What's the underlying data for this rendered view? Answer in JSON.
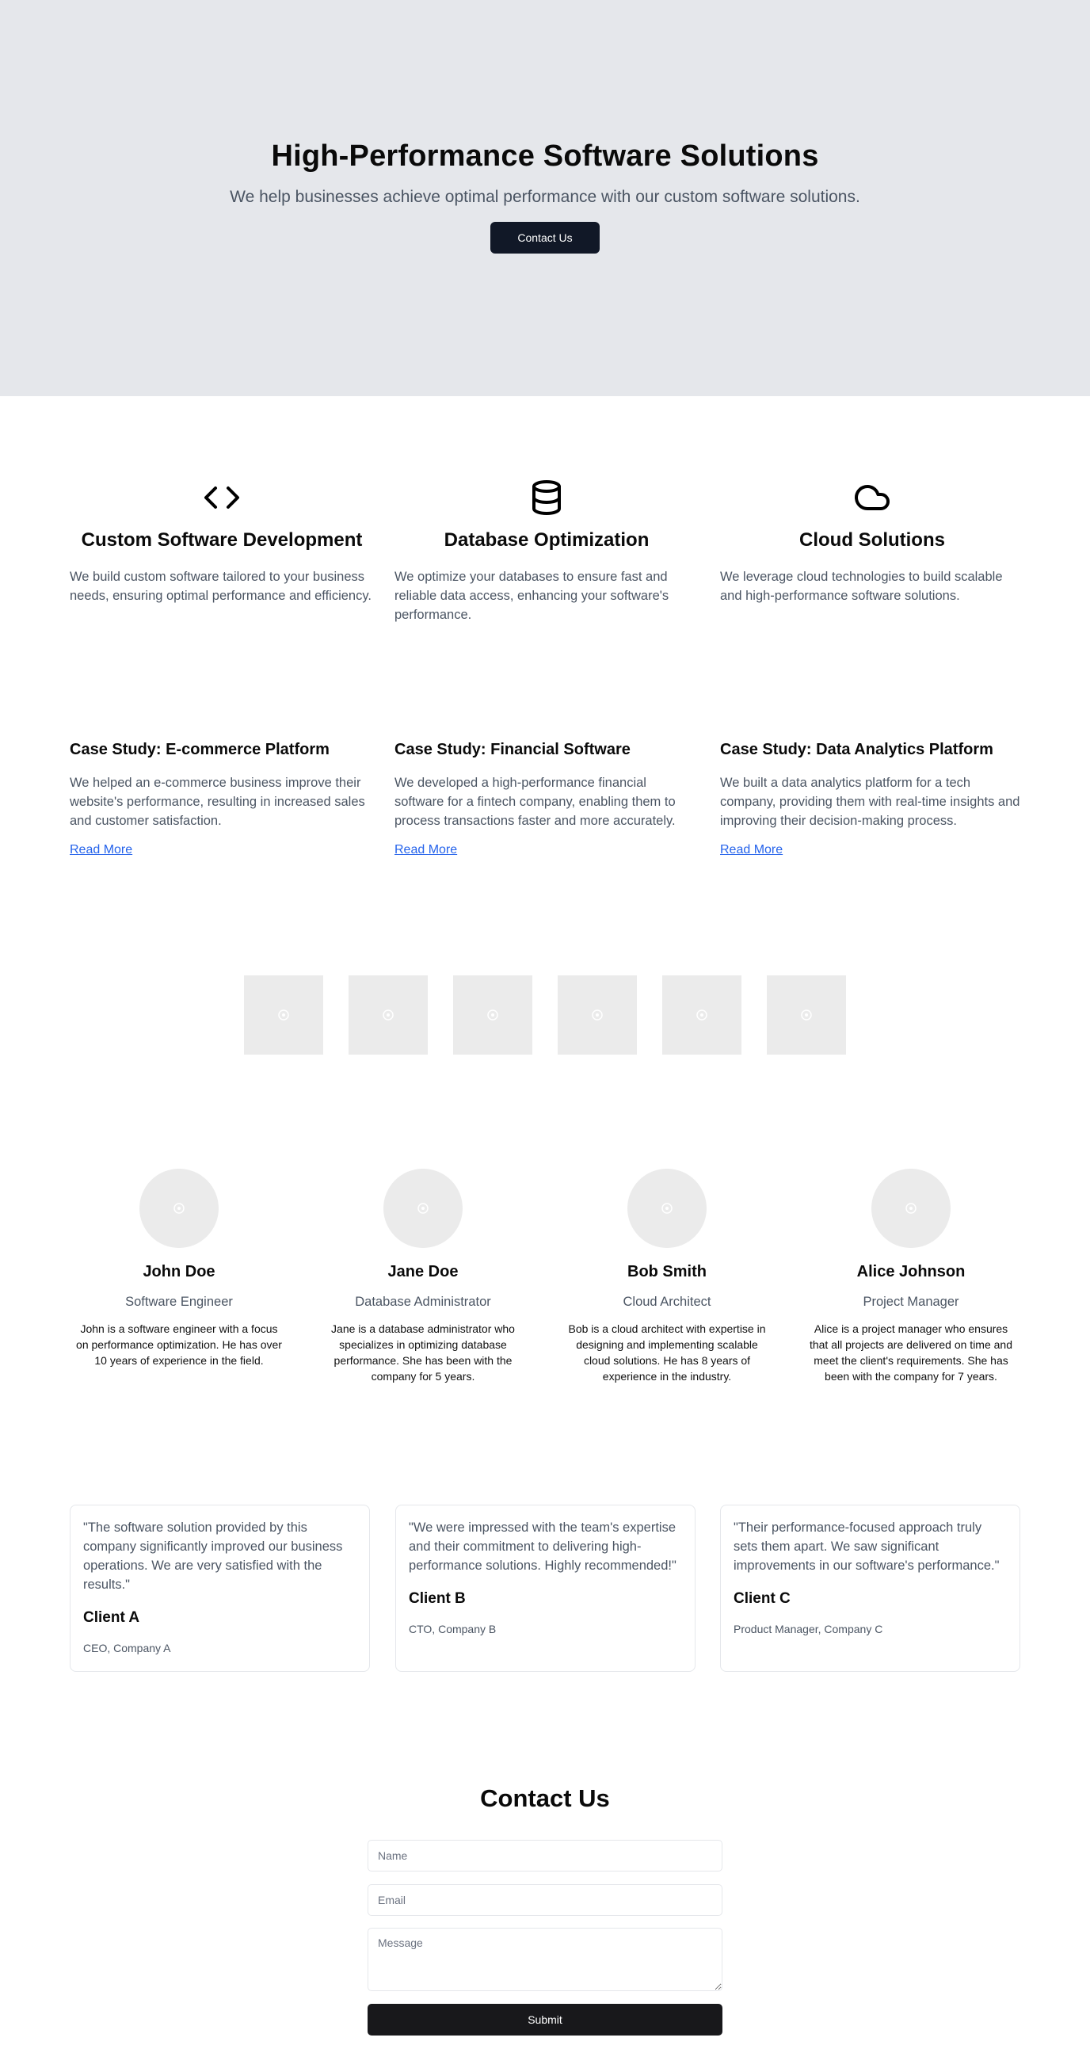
{
  "hero": {
    "title": "High-Performance Software Solutions",
    "subtitle": "We help businesses achieve optimal performance with our custom software solutions.",
    "cta_label": "Contact Us",
    "background": "#e5e7eb",
    "button_color": "#111827"
  },
  "services": [
    {
      "icon": "code-icon",
      "title": "Custom Software Development",
      "description": "We build custom software tailored to your business needs, ensuring optimal performance and efficiency."
    },
    {
      "icon": "database-icon",
      "title": "Database Optimization",
      "description": "We optimize your databases to ensure fast and reliable data access, enhancing your software's performance."
    },
    {
      "icon": "cloud-icon",
      "title": "Cloud Solutions",
      "description": "We leverage cloud technologies to build scalable and high-performance software solutions."
    }
  ],
  "case_studies": [
    {
      "title": "Case Study: E-commerce Platform",
      "description": "We helped an e-commerce business improve their website's performance, resulting in increased sales and customer satisfaction.",
      "link": "Read More"
    },
    {
      "title": "Case Study: Financial Software",
      "description": "We developed a high-performance financial software for a fintech company, enabling them to process transactions faster and more accurately.",
      "link": "Read More"
    },
    {
      "title": "Case Study: Data Analytics Platform",
      "description": "We built a data analytics platform for a tech company, providing them with real-time insights and improving their decision-making process.",
      "link": "Read More"
    }
  ],
  "logos": [
    "image-placeholder-icon",
    "image-placeholder-icon",
    "image-placeholder-icon",
    "image-placeholder-icon",
    "image-placeholder-icon",
    "image-placeholder-icon"
  ],
  "team": [
    {
      "name": "John Doe",
      "role": "Software Engineer",
      "bio": "John is a software engineer with a focus on performance optimization. He has over 10 years of experience in the field."
    },
    {
      "name": "Jane Doe",
      "role": "Database Administrator",
      "bio": "Jane is a database administrator who specializes in optimizing database performance. She has been with the company for 5 years."
    },
    {
      "name": "Bob Smith",
      "role": "Cloud Architect",
      "bio": "Bob is a cloud architect with expertise in designing and implementing scalable cloud solutions. He has 8 years of experience in the industry."
    },
    {
      "name": "Alice Johnson",
      "role": "Project Manager",
      "bio": "Alice is a project manager who ensures that all projects are delivered on time and meet the client's requirements. She has been with the company for 7 years."
    }
  ],
  "testimonials": [
    {
      "quote": "\"The software solution provided by this company significantly improved our business operations. We are very satisfied with the results.\"",
      "client": "Client A",
      "title": "CEO, Company A"
    },
    {
      "quote": "\"We were impressed with the team's expertise and their commitment to delivering high-performance solutions. Highly recommended!\"",
      "client": "Client B",
      "title": "CTO, Company B"
    },
    {
      "quote": "\"Their performance-focused approach truly sets them apart. We saw significant improvements in our software's performance.\"",
      "client": "Client C",
      "title": "Product Manager, Company C"
    }
  ],
  "contact": {
    "title": "Contact Us",
    "name_placeholder": "Name",
    "email_placeholder": "Email",
    "message_placeholder": "Message",
    "submit_label": "Submit"
  }
}
